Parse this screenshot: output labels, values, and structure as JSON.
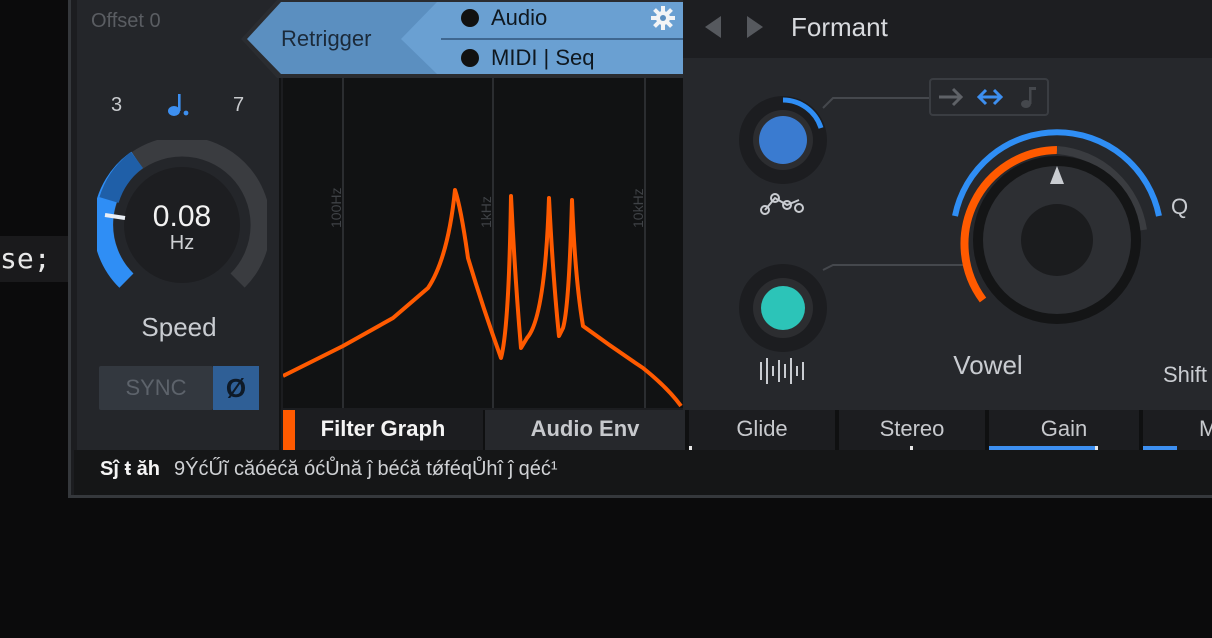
{
  "code_fragment": "se;",
  "lfo": {
    "offset_label": "Offset 0",
    "div_left": "3",
    "div_right": "7",
    "note_icon": "dotted-quarter-note-icon",
    "speed_value": "0.08",
    "speed_unit": "Hz",
    "speed_label": "Speed",
    "sync_label": "SYNC",
    "phase_label": "Ø",
    "speed_level": 0.35
  },
  "retrigger": {
    "label": "Retrigger",
    "options": [
      "Audio",
      "MIDI | Seq"
    ],
    "settings_icon": "gear-icon"
  },
  "filter_graph": {
    "freq_labels": [
      "100Hz",
      "1kHz",
      "10kHz"
    ],
    "curve_color": "#ff5a00"
  },
  "formant": {
    "title": "Formant",
    "prev_icon": "chevron-left-icon",
    "next_icon": "chevron-right-icon",
    "mode_icons": [
      "arrow-right-icon",
      "arrow-left-right-icon",
      "note-icon"
    ],
    "knob_icons": [
      "curve-nodes-icon",
      "waveform-icon"
    ],
    "vowel_label": "Vowel",
    "q_label": "Q",
    "shift_label": "Shift"
  },
  "tabs": [
    {
      "label": "Filter Graph"
    },
    {
      "label": "Audio Env"
    },
    {
      "label": "Glide"
    },
    {
      "label": "Stereo"
    },
    {
      "label": "Gain"
    },
    {
      "label": "M"
    }
  ],
  "status": {
    "key": "Sĵ ŧ ăh",
    "message": "9ÝćŰĩ căóéćă óćŮnă ĵ béćă tǿféqŮhî ĵ qéć¹"
  },
  "colors": {
    "accent_blue": "#3d8ff0",
    "accent_orange": "#ff5a00",
    "teal": "#2cc4b8",
    "header_blue": "#5b8fc0"
  }
}
